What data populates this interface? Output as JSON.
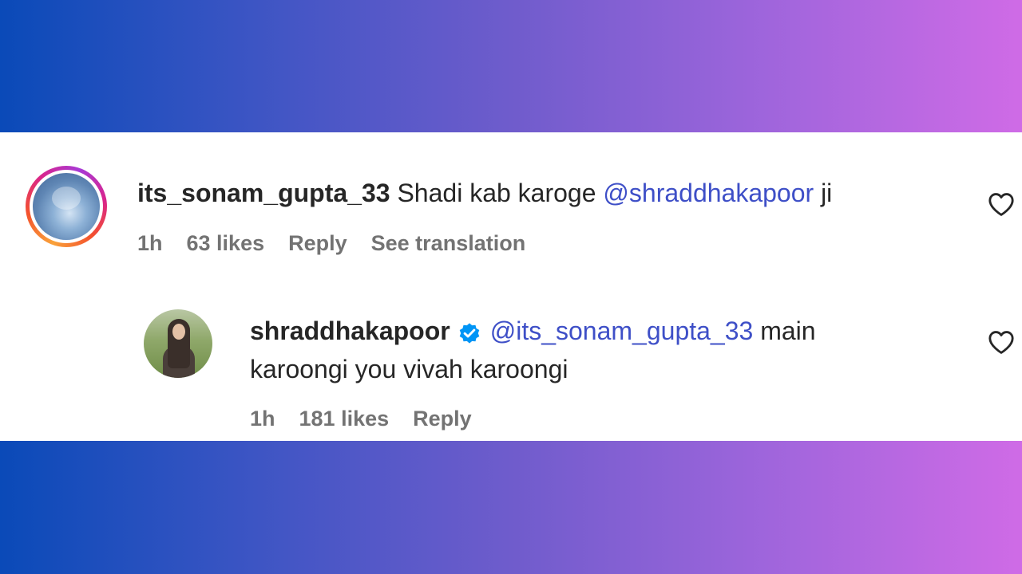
{
  "comment": {
    "username": "its_sonam_gupta_33",
    "text": "Shadi kab karoge",
    "mention": "@shraddhakapoor",
    "text_after": "ji",
    "time": "1h",
    "likes": "63 likes",
    "reply_label": "Reply",
    "translation_label": "See translation"
  },
  "reply": {
    "username": "shraddhakapoor",
    "mention": "@its_sonam_gupta_33",
    "text_line1": "main",
    "text_line2": "karoongi you vivah karoongi",
    "time": "1h",
    "likes": "181 likes",
    "reply_label": "Reply"
  },
  "icons": {
    "like": "heart-outline-icon",
    "verified": "verified-badge-icon"
  },
  "colors": {
    "mention": "#3e4fc7",
    "verified": "#0095f6",
    "gradient_start": "#0a4ab8",
    "gradient_end": "#cf6be6"
  }
}
